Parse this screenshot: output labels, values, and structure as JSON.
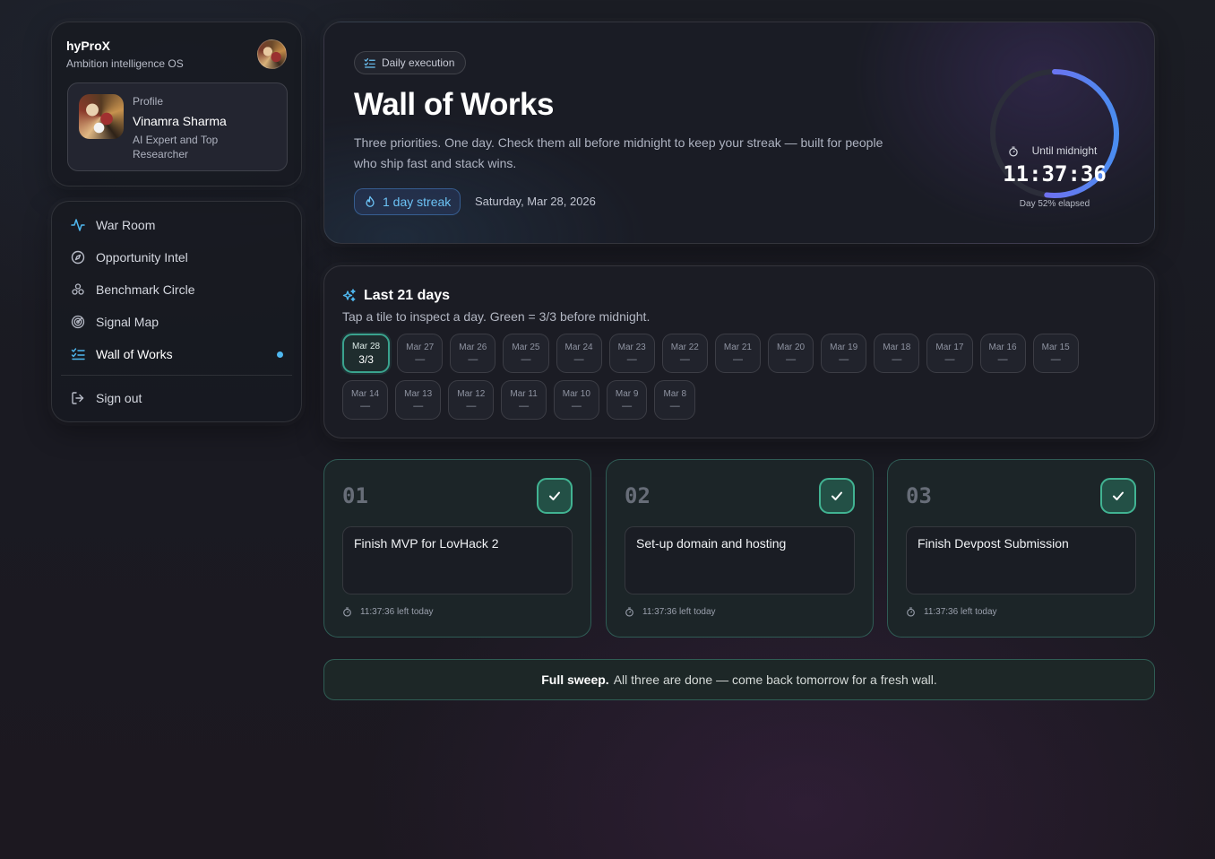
{
  "brand": {
    "name": "hyProX",
    "tagline": "Ambition intelligence OS"
  },
  "profile": {
    "label": "Profile",
    "name": "Vinamra Sharma",
    "role": "AI Expert and Top Researcher"
  },
  "nav": {
    "items": [
      {
        "label": "War Room",
        "icon": "activity-icon"
      },
      {
        "label": "Opportunity Intel",
        "icon": "compass-icon"
      },
      {
        "label": "Benchmark Circle",
        "icon": "people-icon"
      },
      {
        "label": "Signal Map",
        "icon": "radar-icon"
      },
      {
        "label": "Wall of Works",
        "icon": "checklist-icon",
        "active": true
      }
    ],
    "sign_out": "Sign out"
  },
  "hero": {
    "chip": "Daily execution",
    "title": "Wall of Works",
    "description": "Three priorities. One day. Check them all before midnight to keep your streak — built for people who ship fast and stack wins.",
    "streak": "1 day streak",
    "date": "Saturday, Mar 28, 2026",
    "countdown": {
      "label": "Until midnight",
      "time": "11:37:36",
      "elapsed_text": "Day 52% elapsed",
      "elapsed_fraction": 0.52
    }
  },
  "history": {
    "title": "Last 21 days",
    "subtitle": "Tap a tile to inspect a day. Green = 3/3 before midnight.",
    "days": [
      {
        "date": "Mar 28",
        "value": "3/3",
        "done": true
      },
      {
        "date": "Mar 27",
        "value": "—"
      },
      {
        "date": "Mar 26",
        "value": "—"
      },
      {
        "date": "Mar 25",
        "value": "—"
      },
      {
        "date": "Mar 24",
        "value": "—"
      },
      {
        "date": "Mar 23",
        "value": "—"
      },
      {
        "date": "Mar 22",
        "value": "—"
      },
      {
        "date": "Mar 21",
        "value": "—"
      },
      {
        "date": "Mar 20",
        "value": "—"
      },
      {
        "date": "Mar 19",
        "value": "—"
      },
      {
        "date": "Mar 18",
        "value": "—"
      },
      {
        "date": "Mar 17",
        "value": "—"
      },
      {
        "date": "Mar 16",
        "value": "—"
      },
      {
        "date": "Mar 15",
        "value": "—"
      },
      {
        "date": "Mar 14",
        "value": "—"
      },
      {
        "date": "Mar 13",
        "value": "—"
      },
      {
        "date": "Mar 12",
        "value": "—"
      },
      {
        "date": "Mar 11",
        "value": "—"
      },
      {
        "date": "Mar 10",
        "value": "—"
      },
      {
        "date": "Mar 9",
        "value": "—"
      },
      {
        "date": "Mar 8",
        "value": "—"
      }
    ]
  },
  "tasks": [
    {
      "number": "01",
      "text": "Finish MVP for LovHack 2",
      "time_left": "11:37:36 left today",
      "done": true
    },
    {
      "number": "02",
      "text": "Set-up domain and hosting",
      "time_left": "11:37:36 left today",
      "done": true
    },
    {
      "number": "03",
      "text": "Finish Devpost Submission",
      "time_left": "11:37:36 left today",
      "done": true
    }
  ],
  "sweep": {
    "bold": "Full sweep.",
    "text": "All three are done — come back tomorrow for a fresh wall."
  },
  "colors": {
    "accent_blue": "#4fb8f0",
    "success_green": "#41b392",
    "ring_purple": "#8a5cf0"
  }
}
